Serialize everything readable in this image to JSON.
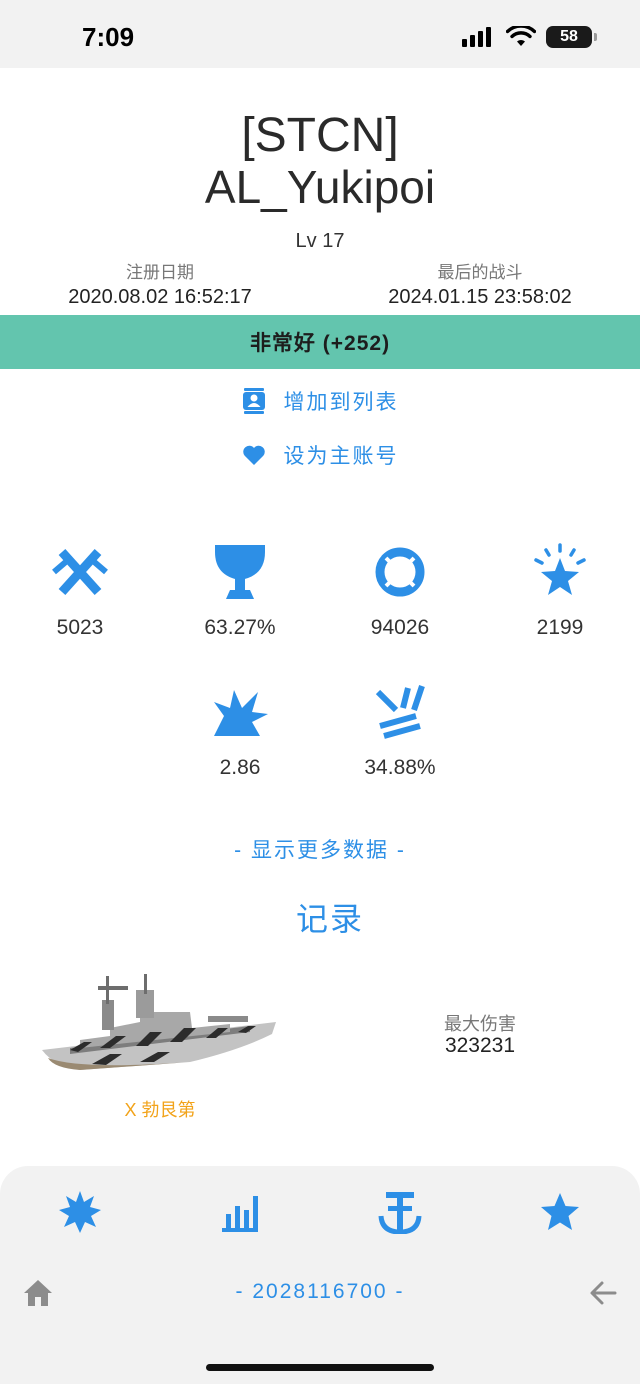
{
  "status": {
    "time": "7:09",
    "battery": "58"
  },
  "player": {
    "clan": "[STCN]",
    "name": "AL_Yukipoi",
    "level": "Lv 17",
    "register_label": "注册日期",
    "register_date": "2020.08.02 16:52:17",
    "last_battle_label": "最后的战斗",
    "last_battle_date": "2024.01.15 23:58:02",
    "rating": "非常好 (+252)"
  },
  "colors": {
    "accent": "#2d8fe6",
    "rating": "#63c5ae",
    "ship_tier": "#f2a31a"
  },
  "actions": [
    {
      "label": "增加到列表",
      "icon": "contact-card-icon"
    },
    {
      "label": "设为主账号",
      "icon": "heart-icon"
    }
  ],
  "stats": [
    {
      "icon": "crossed-swords-icon",
      "value": "5023"
    },
    {
      "icon": "trophy-icon",
      "value": "63.27%"
    },
    {
      "icon": "lifebuoy-icon",
      "value": "94026"
    },
    {
      "icon": "sparkle-star-icon",
      "value": "2199"
    },
    {
      "icon": "explosion-icon",
      "value": "2.86"
    },
    {
      "icon": "shell-hit-icon",
      "value": "34.88%"
    }
  ],
  "show_more": "- 显示更多数据 -",
  "records": {
    "title": "记录",
    "ship_name": "X 勃艮第",
    "max_damage_label": "最大伤害",
    "max_damage_value": "323231"
  },
  "tabs": [
    {
      "icon": "burst-icon"
    },
    {
      "icon": "bar-chart-icon"
    },
    {
      "icon": "anchor-icon"
    },
    {
      "icon": "star-icon"
    }
  ],
  "footer": {
    "account_id": "- 2028116700 -",
    "home_icon": "home-icon",
    "back_icon": "back-arrow-icon"
  }
}
